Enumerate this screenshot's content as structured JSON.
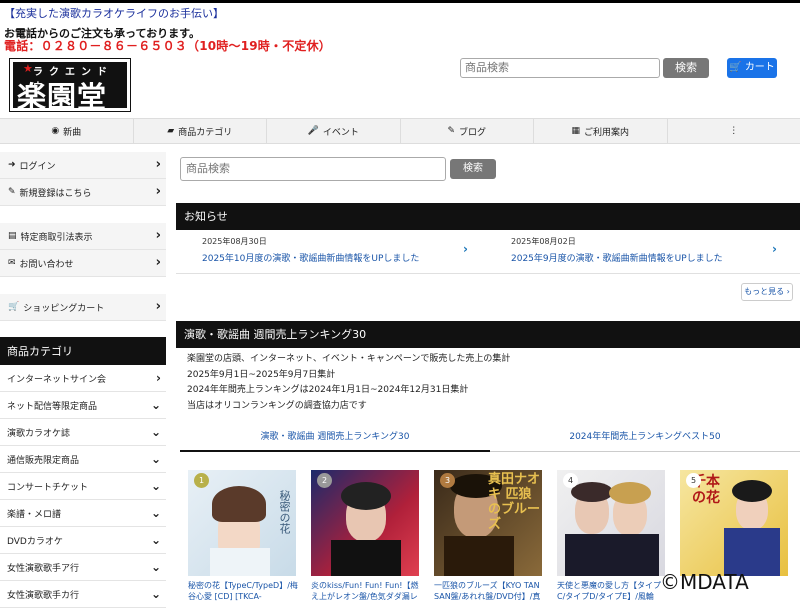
{
  "header": {
    "tagline": "【充実した演歌カラオケライフのお手伝い】",
    "phone_notice": "お電話からのご注文も承っております。",
    "phone": "電話：０２８０－８６－６５０３（10時〜19時・不定休）",
    "logo_kana": "ラクエンドウ",
    "logo_kanji": "楽園堂",
    "search_placeholder": "商品検索",
    "search_button": "検索",
    "cart_button": "カート"
  },
  "nav": [
    {
      "label": "新曲",
      "icon": "disc-icon"
    },
    {
      "label": "商品カテゴリ",
      "icon": "folder-icon"
    },
    {
      "label": "イベント",
      "icon": "microphone-icon"
    },
    {
      "label": "ブログ",
      "icon": "edit-icon"
    },
    {
      "label": "ご利用案内",
      "icon": "map-icon"
    },
    {
      "label": "",
      "icon": "more-vertical-icon"
    }
  ],
  "sidebar": {
    "account": [
      {
        "label": "ログイン",
        "icon": "login-icon"
      },
      {
        "label": "新規登録はこちら",
        "icon": "pencil-icon"
      }
    ],
    "info": [
      {
        "label": "特定商取引法表示",
        "icon": "document-icon"
      },
      {
        "label": "お問い合わせ",
        "icon": "mail-icon"
      }
    ],
    "cart": {
      "label": "ショッピングカート",
      "icon": "cart-icon"
    },
    "category_heading": "商品カテゴリ",
    "categories": [
      {
        "label": "インターネットサイン会",
        "chev": "›"
      },
      {
        "label": "ネット配信等限定商品",
        "chev": "⌄"
      },
      {
        "label": "演歌カラオケ誌",
        "chev": "⌄"
      },
      {
        "label": "通信販売限定商品",
        "chev": "⌄"
      },
      {
        "label": "コンサートチケット",
        "chev": "⌄"
      },
      {
        "label": "楽譜・メロ譜",
        "chev": "⌄"
      },
      {
        "label": "DVDカラオケ",
        "chev": "⌄"
      },
      {
        "label": "女性演歌歌手ア行",
        "chev": "⌄"
      },
      {
        "label": "女性演歌歌手カ行",
        "chev": "⌄"
      }
    ]
  },
  "main": {
    "search_placeholder": "商品検索",
    "search_button": "検索",
    "news_heading": "お知らせ",
    "news": [
      {
        "date": "2025年08月30日",
        "title": "2025年10月度の演歌・歌謡曲新曲情報をUPしました"
      },
      {
        "date": "2025年08月02日",
        "title": "2025年9月度の演歌・歌謡曲新曲情報をUPしました"
      }
    ],
    "more_button": "もっと見る ›",
    "ranking_heading": "演歌・歌謡曲 週間売上ランキング30",
    "ranking_desc": [
      "楽園堂の店頭、インターネット、イベント・キャンペーンで販売した売上の集計",
      "2025年9月1日~2025年9月7日集計",
      "2024年年間売上ランキングは2024年1月1日~2024年12月31日集計",
      "当店はオリコンランキングの調査協力店です"
    ],
    "tabs": [
      "演歌・歌謡曲 週間売上ランキング30",
      "2024年年間売上ランキングベスト50"
    ],
    "products": [
      {
        "rank": "1",
        "badge_color": "#b8b04a",
        "caption": "秘密の花【TypeC/TypeD】/梅谷心愛 [CD] [TKCA-",
        "cover_text": "秘密の花"
      },
      {
        "rank": "2",
        "badge_color": "#999999",
        "caption": "炎のkiss/Fun! Fun! Fun!【燃え上がレオン盤/色気ダダ漏レオン",
        "cover_text": ""
      },
      {
        "rank": "3",
        "badge_color": "#b07a40",
        "caption": "一匹狼のブルーズ【KYO TAN SAN盤/あれれ盤/DVD付】/真",
        "cover_text": "真田ナオキ 匹狼のブルーズ"
      },
      {
        "rank": "4",
        "badge_color": "#ffffff",
        "caption": "天使と悪魔の愛し方【タイプC/タイプD/タイプE】/風輪 [CD]",
        "cover_text": ""
      },
      {
        "rank": "5",
        "badge_color": "#ffffff",
        "caption": "",
        "cover_text": "千本の花"
      }
    ]
  },
  "watermark": "©MDATA"
}
